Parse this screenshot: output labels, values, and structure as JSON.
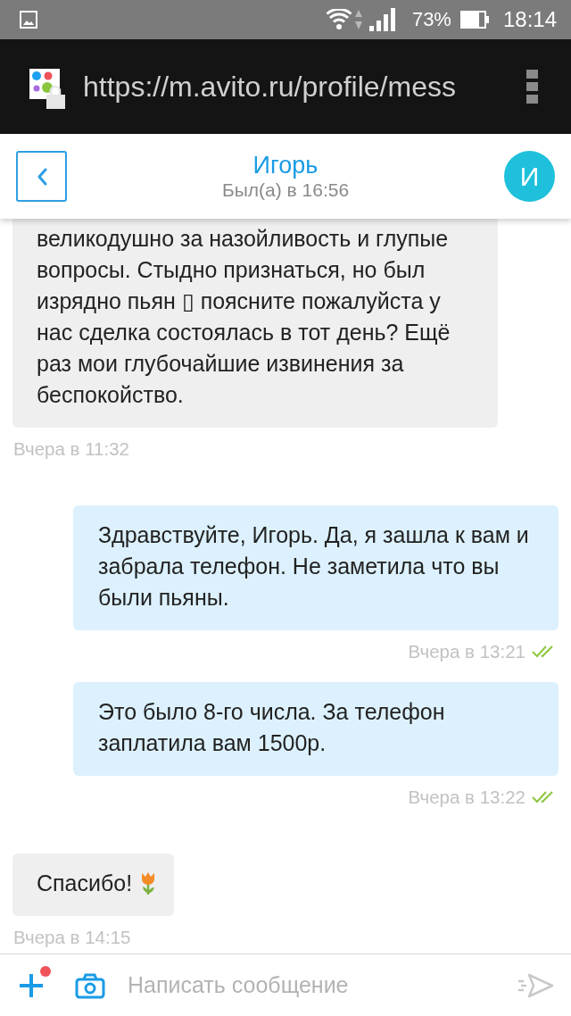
{
  "status_bar": {
    "battery": "73%",
    "time": "18:14"
  },
  "browser": {
    "url": "https://m.avito.ru/profile/mess"
  },
  "header": {
    "name": "Игорь",
    "last_seen": "Был(а) в 16:56",
    "avatar_letter": "И"
  },
  "messages": [
    {
      "kind": "incoming",
      "text": "великодушно за назойливость и глупые вопросы. Стыдно признаться, но был изрядно пьян ▯ поясните пожалуйста у нас сделка состоялась в тот день? Ещё раз мои глубочайшие извинения за беспокойство.",
      "time": "Вчера в 11:32"
    },
    {
      "kind": "outgoing",
      "text": "Здравствуйте, Игорь. Да, я зашла к вам и забрала телефон. Не заметила что вы были пьяны.",
      "time": "Вчера в 13:21",
      "read": true
    },
    {
      "kind": "outgoing",
      "text": "Это было 8-го числа. За телефон заплатила вам 1500р.",
      "time": "Вчера в 13:22",
      "read": true
    },
    {
      "kind": "incoming",
      "text": "Спасибо!",
      "emoji": true,
      "time": "Вчера в 14:15"
    }
  ],
  "composer": {
    "placeholder": "Написать сообщение",
    "attach_notification": true
  }
}
